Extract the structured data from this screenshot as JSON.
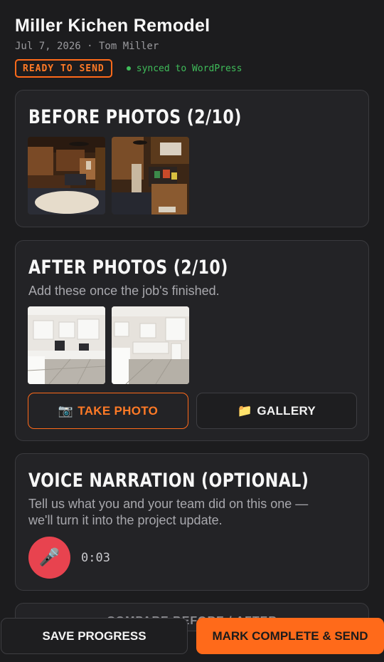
{
  "header": {
    "title": "Miller Kichen Remodel",
    "meta": "Jul 7, 2026 · Tom Miller",
    "status_badge": "READY TO SEND",
    "sync_status": "synced to WordPress"
  },
  "before": {
    "title": "BEFORE PHOTOS (2/10)",
    "photos": [
      "before-photo-1",
      "before-photo-2"
    ]
  },
  "after": {
    "title": "AFTER PHOTOS (2/10)",
    "subtitle": "Add these once the job's finished.",
    "photos": [
      "after-photo-1",
      "after-photo-2"
    ],
    "take_photo_label": "TAKE PHOTO",
    "take_photo_icon": "📷",
    "gallery_label": "GALLERY",
    "gallery_icon": "📁"
  },
  "voice": {
    "title": "VOICE NARRATION (OPTIONAL)",
    "subtitle_line1": "Tell us what you and your team did on this one —",
    "subtitle_line2": "we'll turn it into the project update.",
    "mic_icon": "🎤",
    "timer": "0:03"
  },
  "next_section_peek": "COMPARE BEFORE / AFTER",
  "footer": {
    "save_label": "SAVE PROGRESS",
    "send_label": "MARK COMPLETE & SEND"
  },
  "colors": {
    "accent": "#ff6a1a",
    "success": "#3fbd5a",
    "record": "#e8434f",
    "background": "#1c1c1e",
    "card": "#232326"
  }
}
